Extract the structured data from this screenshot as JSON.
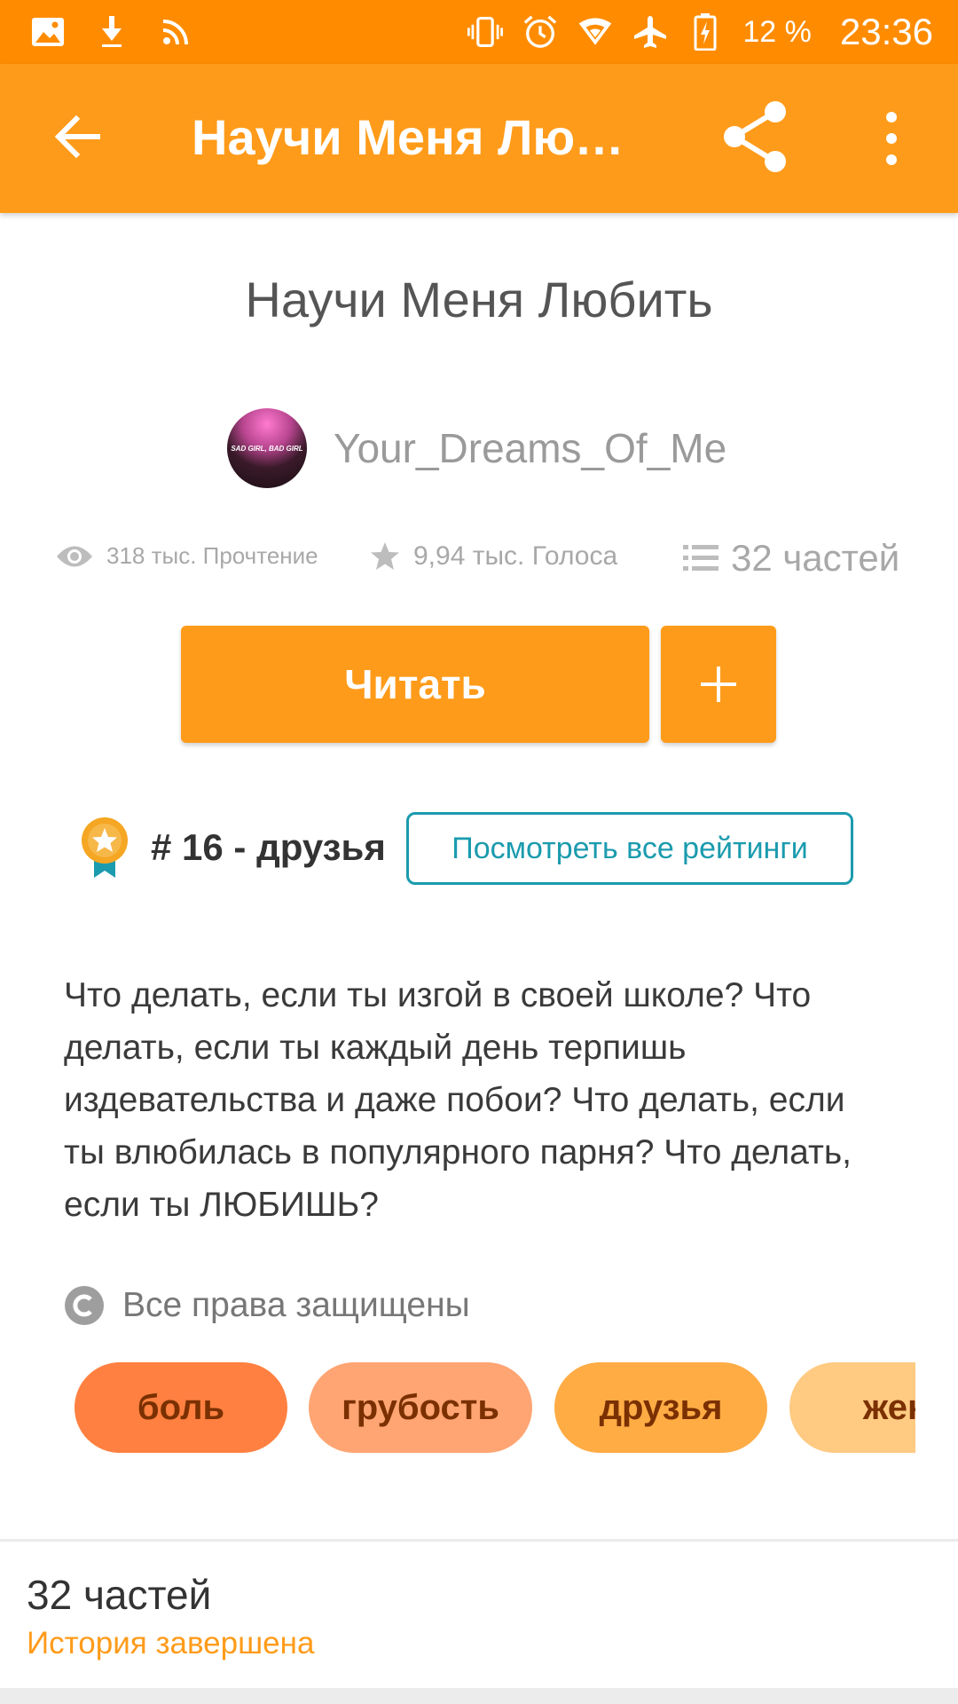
{
  "status_bar": {
    "battery_percent": "12 %",
    "time": "23:36"
  },
  "app_bar": {
    "title": "Научи Меня Любить",
    "icons": [
      "back-arrow-icon",
      "share-icon",
      "more-vert-icon"
    ]
  },
  "story": {
    "title": "Научи Меня Любить",
    "author": "Your_Dreams_Of_Me",
    "avatar_text": "SAD GIRL, BAD GIRL",
    "stats": {
      "reads": "318 тыс. Прочтение",
      "votes": "9,94 тыс. Голоса",
      "parts": "32 частей"
    },
    "read_button": "Читать",
    "add_button": "+",
    "ranking": {
      "label": "# 16 - друзья",
      "view_all": "Посмотреть все рейтинги"
    },
    "description": "Что делать, если ты изгой в своей школе? Что делать, если ты каждый день терпишь издевательства и даже побои? Что делать, если ты влюбилась в популярного парня? Что делать, если ты ЛЮБИШЬ?",
    "copyright": "Все права защищены",
    "tags": [
      "боль",
      "грубость",
      "друзья",
      "жен"
    ]
  },
  "parts_summary": {
    "count": "32 частей",
    "status": "История завершена"
  },
  "colors": {
    "status_bar": "#FF8C00",
    "app_bar": "#FF9B1A",
    "accent_teal": "#1B9BAE",
    "tag1": "#FF8040",
    "tag2": "#FFA573",
    "tag3": "#FFAC45",
    "tag4": "#FFCA82"
  }
}
